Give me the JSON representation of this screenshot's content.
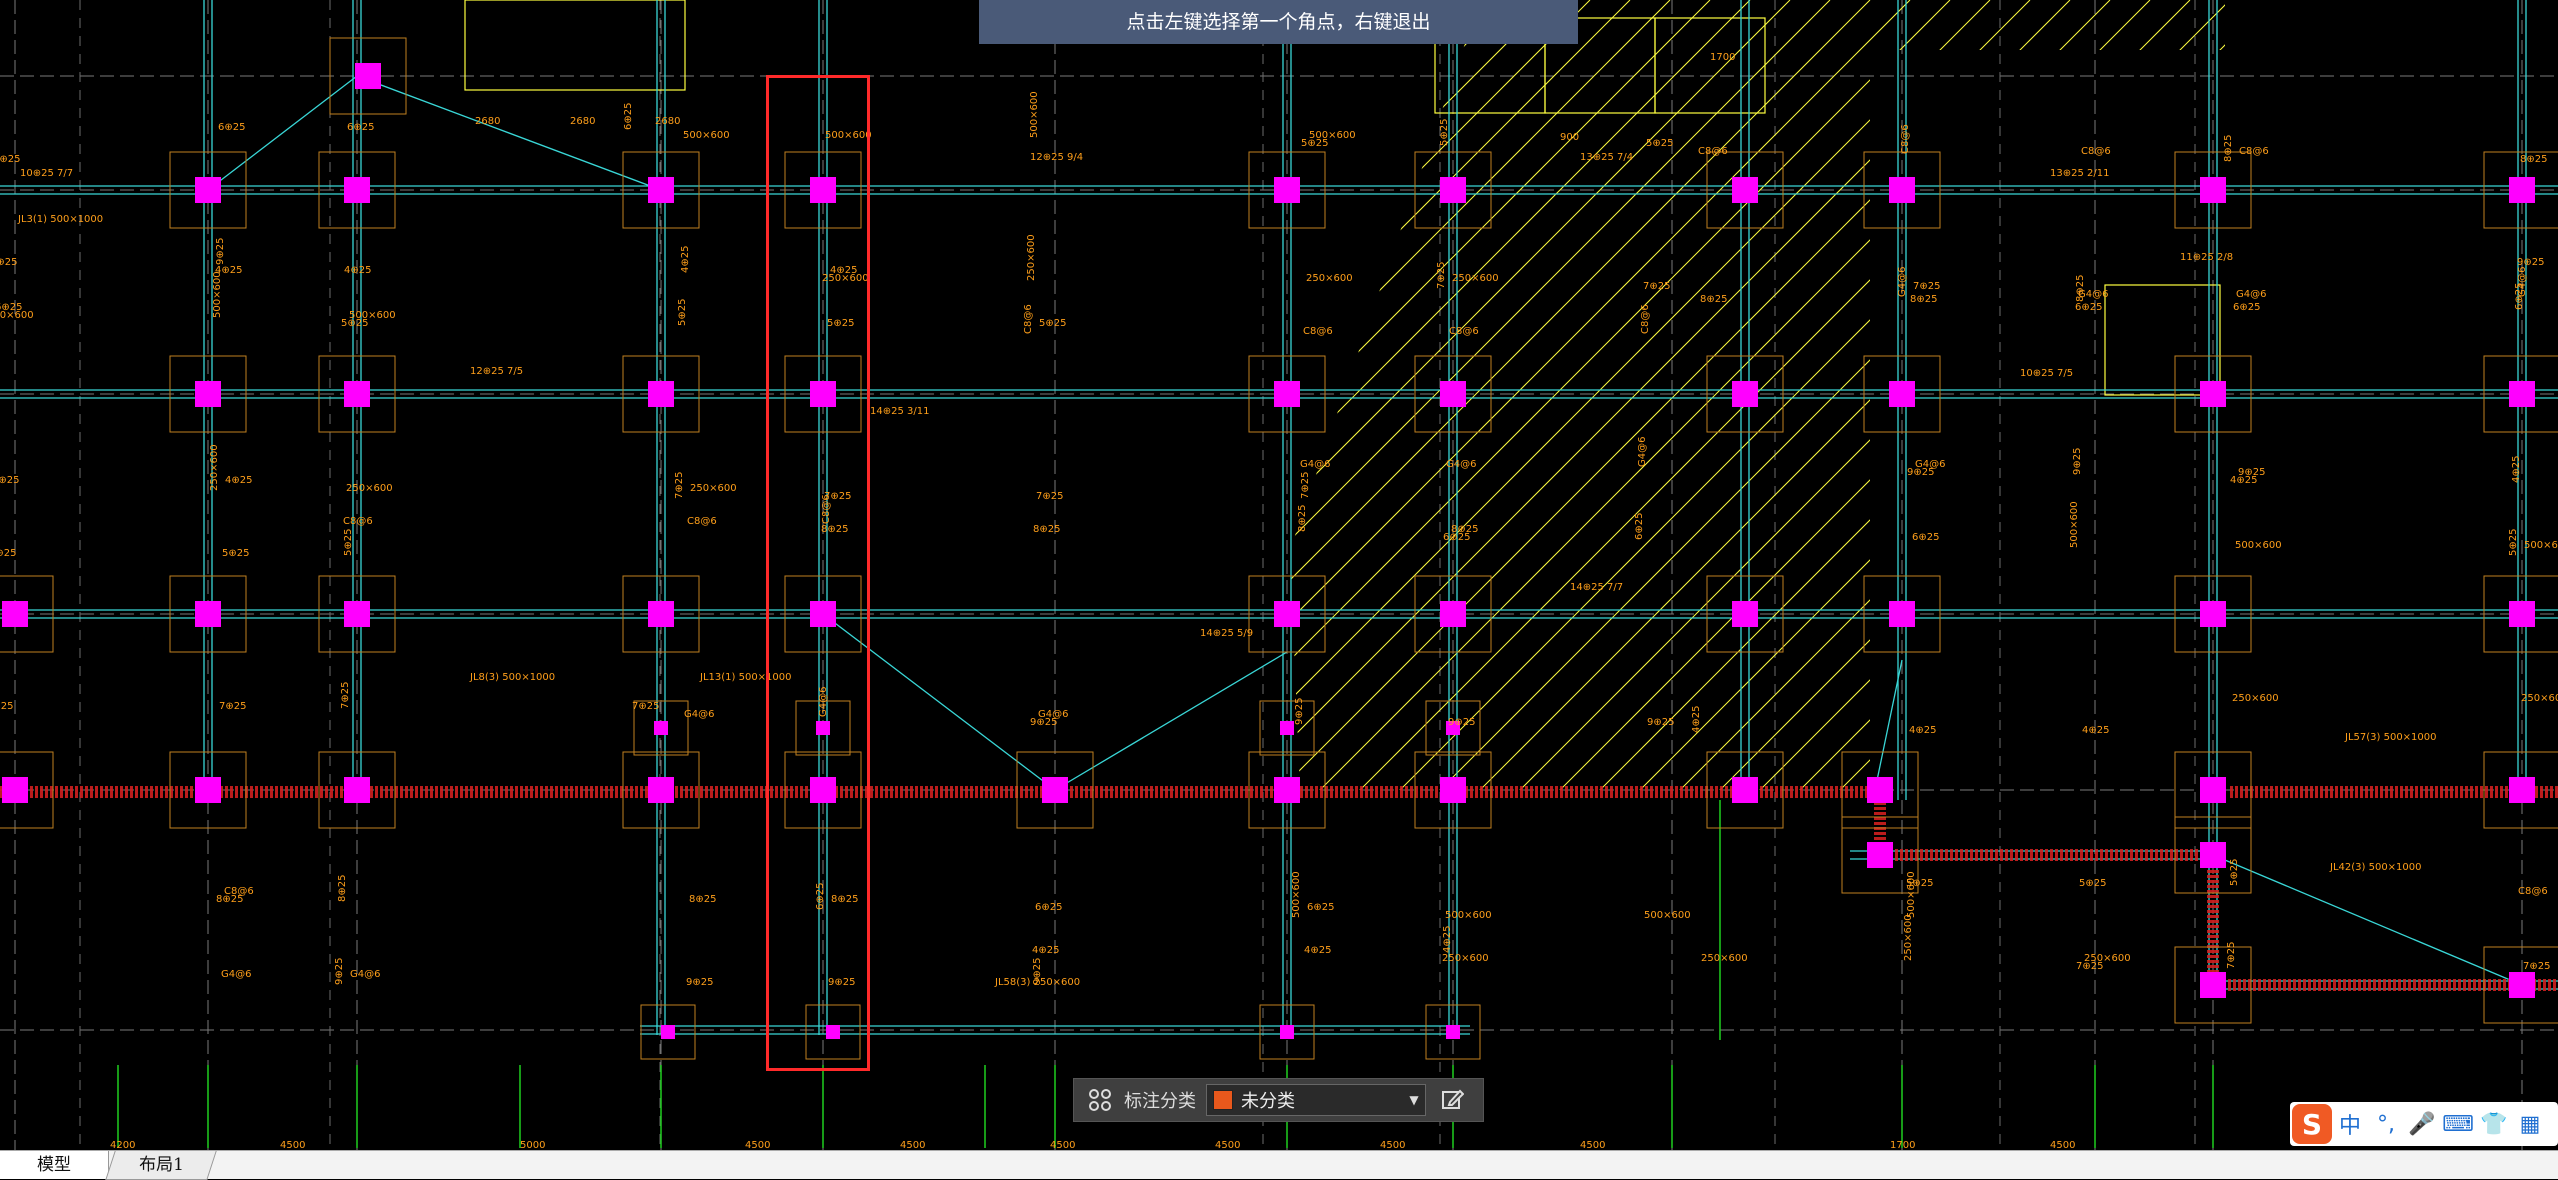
{
  "hint": {
    "text": "点击左键选择第一个角点，右键退出"
  },
  "annotation_toolbar": {
    "label": "标注分类",
    "dropdown_value": "未分类",
    "dropdown_color": "#e8581c"
  },
  "tabs": [
    {
      "label": "模型",
      "active": true
    },
    {
      "label": "布局1",
      "active": false
    }
  ],
  "ime": {
    "logo_letter": "S",
    "items": [
      "中",
      "°,",
      "🎤",
      "⌨",
      "👕",
      "▦"
    ]
  },
  "colors": {
    "background": "#000000",
    "grid_line": "#7a7a7a",
    "beam": "#39d6d6",
    "column_fill": "#ff00ff",
    "column_box": "#c08020",
    "annotation_text": "#ff9f1a",
    "hatch": "#ffff40",
    "red_beam": "#d02020",
    "axis_green": "#1fcf1f",
    "selection": "#ff2a2a"
  },
  "drawing_labels": {
    "bottom_dims": [
      "4200",
      "4500",
      "5000",
      "4500",
      "4500",
      "4500",
      "4500",
      "4500",
      "4500",
      "1700",
      "4500"
    ],
    "top_dims": [
      "2680",
      "2680",
      "2680",
      "900",
      "1700"
    ],
    "beam_marks": [
      "10⊕25 7/7",
      "12⊕25 7/5",
      "14⊕25 3/11",
      "14⊕25 5/9",
      "12⊕25 9/4",
      "13⊕25 7/4",
      "10⊕25 7/5",
      "14⊕25 7/7",
      "11⊕25 2/8",
      "13⊕25 2/11"
    ],
    "beam_specs": [
      "JL3(1) 500×1000",
      "JL8(3) 500×1000",
      "JL13(1) 500×1000",
      "JL58(3) 250×600",
      "JL57(3) 500×1000",
      "JL42(3) 500×1000"
    ],
    "small_texts": [
      "6⊕25",
      "4⊕25",
      "5⊕25",
      "7⊕25",
      "8⊕25",
      "9⊕25",
      "500×600",
      "250×600",
      "C8@6",
      "G4@6"
    ]
  }
}
